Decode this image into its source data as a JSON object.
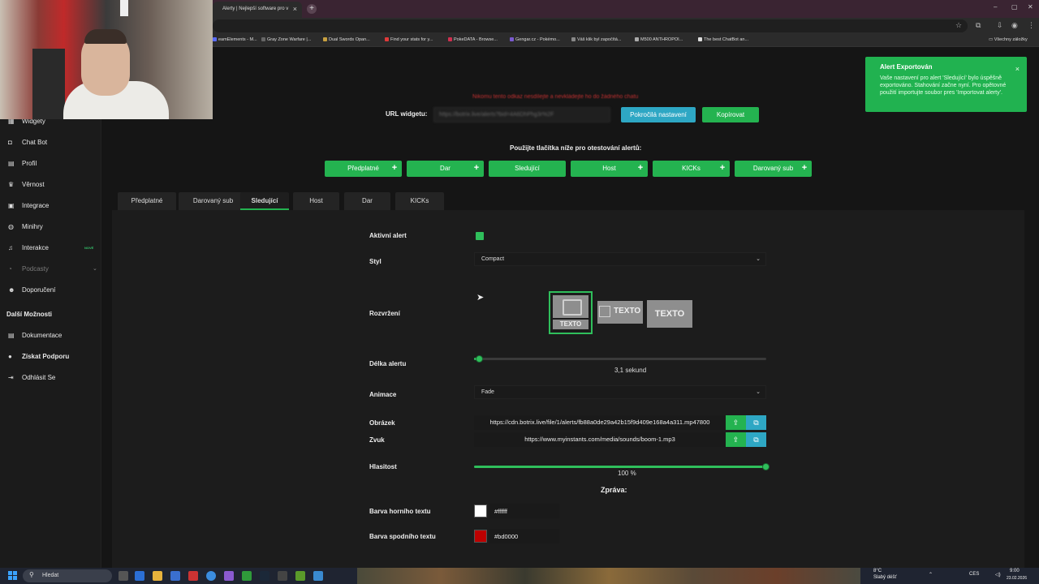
{
  "browser": {
    "tab_title": "Alerty | Nejlepší software pro v",
    "tab_close": "×",
    "new_tab": "+",
    "window_controls": [
      "–",
      "▢",
      "✕"
    ],
    "bookmarks": [
      {
        "label": "eamElements - M...",
        "color": "#5a6cff"
      },
      {
        "label": "Gray Zone Warfare |...",
        "color": "#666666"
      },
      {
        "label": "Dual Swords Opan...",
        "color": "#c8a040"
      },
      {
        "label": "Find your stats for y...",
        "color": "#e03a3a"
      },
      {
        "label": "PokeDATA - Browse...",
        "color": "#d03050"
      },
      {
        "label": "Gengar.cz - Pokémo...",
        "color": "#7a5ad0"
      },
      {
        "label": "Váš klik byl započítá...",
        "color": "#888888"
      },
      {
        "label": "M500 ANTHROPOI...",
        "color": "#aaaaaa"
      },
      {
        "label": "The best ChatBot an...",
        "color": "#dddddd"
      }
    ],
    "all_bookmarks": "Všechny záložky"
  },
  "sidebar": {
    "items": [
      {
        "label": "Widgety",
        "icon": "grid-icon",
        "state": "normal"
      },
      {
        "label": "Chat Bot",
        "icon": "robot-icon",
        "state": "normal"
      },
      {
        "label": "Profil",
        "icon": "id-card-icon",
        "state": "normal"
      },
      {
        "label": "Věrnost",
        "icon": "trophy-icon",
        "state": "normal"
      },
      {
        "label": "Integrace",
        "icon": "plug-icon",
        "state": "normal"
      },
      {
        "label": "Minihry",
        "icon": "gamepad-icon",
        "state": "normal"
      },
      {
        "label": "Interakce",
        "icon": "music-icon",
        "state": "normal",
        "badge": "NOVÉ"
      },
      {
        "label": "Podcasty",
        "icon": "podcast-icon",
        "state": "dim"
      },
      {
        "label": "Doporučení",
        "icon": "users-icon",
        "state": "normal"
      }
    ],
    "section_title": "Další Možnosti",
    "extra_items": [
      {
        "label": "Dokumentace",
        "icon": "book-icon"
      },
      {
        "label": "Získat Podporu",
        "icon": "help-icon"
      },
      {
        "label": "Odhlásit Se",
        "icon": "logout-icon"
      }
    ]
  },
  "header": {
    "warning": "Nikomu tento odkaz nesdílejte a nevkládejte ho do žádného chatu",
    "url_label": "URL widgetu:",
    "url_value": "https://botrix.live/alerts?bid=4A6DhPhg3r%2F",
    "advanced_button": "Pokročilá nastavení",
    "copy_button": "Kopírovat",
    "test_hint": "Použijte tlačítka níže pro otestování alertů:",
    "test_buttons": [
      {
        "label": "Předplatné",
        "has_plus": true
      },
      {
        "label": "Dar",
        "has_plus": true
      },
      {
        "label": "Sledující",
        "has_plus": false
      },
      {
        "label": "Host",
        "has_plus": true
      },
      {
        "label": "KICKs",
        "has_plus": true
      },
      {
        "label": "Darovaný sub",
        "has_plus": true
      }
    ]
  },
  "alert_tabs": [
    {
      "label": "Předplatné",
      "active": false
    },
    {
      "label": "Darovaný sub",
      "active": false
    },
    {
      "label": "Sledující",
      "active": true
    },
    {
      "label": "Host",
      "active": false
    },
    {
      "label": "Dar",
      "active": false
    },
    {
      "label": "KICKs",
      "active": false
    }
  ],
  "form": {
    "active_label": "Aktivní alert",
    "active_checked": true,
    "style_label": "Styl",
    "style_value": "Compact",
    "layout_label": "Rozvržení",
    "layout_text": "TEXTO",
    "layout_selected_index": 0,
    "duration_label": "Délka alertu",
    "duration_value": "3,1",
    "duration_unit": "sekund",
    "duration_fraction": 0.02,
    "animation_label": "Animace",
    "animation_value": "Fade",
    "image_label": "Obrázek",
    "image_value": "https://cdn.botrix.live/file/1/alerts/fb88a0de29a42b15f9d409e168a4a311.mp47800",
    "sound_label": "Zvuk",
    "sound_value": "https://www.myinstants.com/media/sounds/boom-1.mp3",
    "volume_label": "Hlasitost",
    "volume_value": "100",
    "volume_unit": "%",
    "volume_fraction": 1.0,
    "message_title": "Zpráva:",
    "top_color_label": "Barva horního textu",
    "top_color_value": "#ffffff",
    "bottom_color_label": "Barva spodního textu",
    "bottom_color_value": "#bd0000"
  },
  "toast": {
    "title": "Alert Exportován",
    "message": "Vaše nastavení pro alert 'Sledující' bylo úspěšně exportováno. Stahování začne nyní. Pro opětovné použití importujte soubor pres 'Importovat alerty'.",
    "close": "×"
  },
  "taskbar": {
    "search_placeholder": "Hledat",
    "weather_temp": "8°C",
    "weather_desc": "Slabý déšť",
    "language": "CES",
    "time": "9:00",
    "date": "23.02.2026"
  },
  "colors": {
    "accent_green": "#24b350",
    "accent_blue": "#2ea7c4",
    "warning_red": "#c03030"
  }
}
